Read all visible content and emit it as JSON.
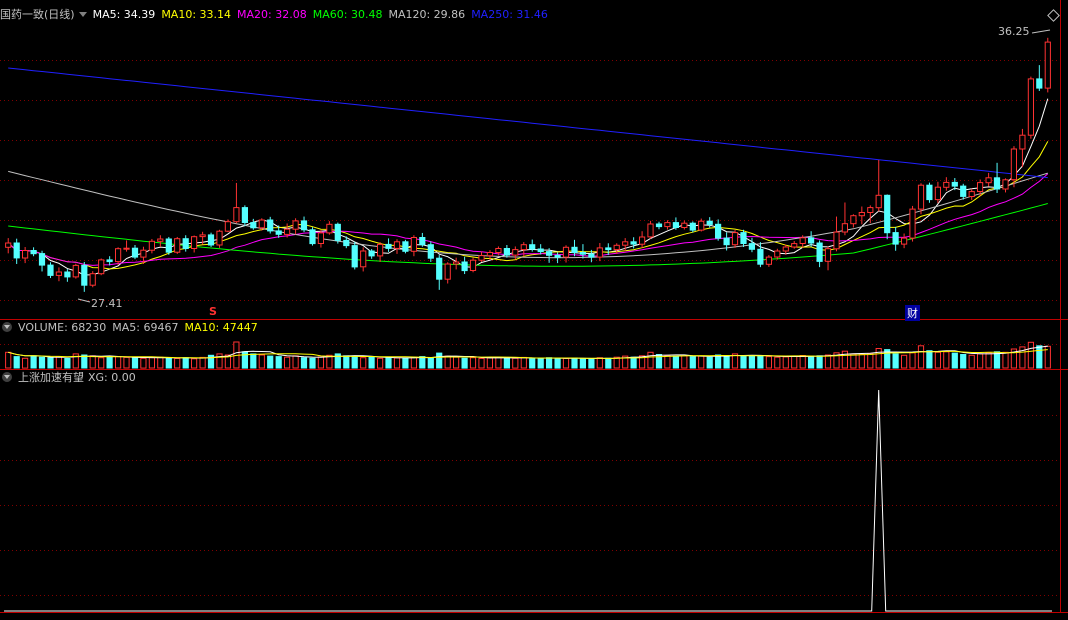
{
  "main_panel": {
    "title": "国药一致(日线)",
    "ma": [
      {
        "label": "MA5: 34.39",
        "color": "#ffffff"
      },
      {
        "label": "MA10: 33.14",
        "color": "#ffff00"
      },
      {
        "label": "MA20: 32.08",
        "color": "#ff00ff"
      },
      {
        "label": "MA60: 30.48",
        "color": "#00ff00"
      },
      {
        "label": "MA120: 29.86",
        "color": "#c0c0c0"
      },
      {
        "label": "MA250: 31.46",
        "color": "#2020ff"
      }
    ],
    "high_label": "36.25",
    "low_label": "27.41",
    "marker_s": "S",
    "marker_cai": "财"
  },
  "volume_panel": {
    "title": "VOLUME: 68230",
    "ma5": "MA5: 69467",
    "ma10": "MA10: 47447"
  },
  "indicator_panel": {
    "title": "上涨加速有望",
    "xg": "XG: 0.00"
  },
  "colors": {
    "up": "#ff3232",
    "down": "#54ffff",
    "grid": "#800000",
    "divider": "#c00000",
    "background": "#000000"
  },
  "chart_data": {
    "type": "candlestick",
    "price_axis": {
      "min": 26.5,
      "max": 36.8
    },
    "notes": "approximate daily OHLC read from the figure",
    "candles": [
      [
        28.96,
        29.28,
        28.75,
        29.11
      ],
      [
        29.11,
        29.26,
        28.38,
        28.59
      ],
      [
        28.59,
        28.97,
        28.41,
        28.85
      ],
      [
        28.85,
        28.96,
        28.65,
        28.74
      ],
      [
        28.74,
        28.84,
        28.12,
        28.34
      ],
      [
        28.34,
        28.44,
        27.89,
        27.98
      ],
      [
        27.98,
        28.26,
        27.78,
        28.1
      ],
      [
        28.1,
        28.2,
        27.76,
        27.93
      ],
      [
        27.93,
        28.39,
        27.87,
        28.33
      ],
      [
        28.33,
        28.45,
        27.41,
        27.64
      ],
      [
        27.64,
        28.13,
        27.57,
        28.04
      ],
      [
        28.04,
        28.57,
        27.99,
        28.52
      ],
      [
        28.52,
        28.65,
        28.33,
        28.46
      ],
      [
        28.46,
        28.96,
        28.35,
        28.91
      ],
      [
        28.91,
        29.2,
        28.81,
        28.93
      ],
      [
        28.93,
        29.04,
        28.55,
        28.62
      ],
      [
        28.62,
        28.98,
        28.38,
        28.86
      ],
      [
        28.86,
        29.25,
        28.75,
        29.17
      ],
      [
        29.17,
        29.38,
        28.97,
        29.25
      ],
      [
        29.25,
        29.32,
        28.7,
        28.79
      ],
      [
        28.79,
        29.32,
        28.73,
        29.26
      ],
      [
        29.26,
        29.38,
        28.81,
        28.92
      ],
      [
        28.92,
        29.37,
        28.78,
        29.33
      ],
      [
        29.33,
        29.5,
        29.06,
        29.39
      ],
      [
        29.39,
        29.47,
        28.97,
        29.04
      ],
      [
        29.04,
        29.57,
        28.94,
        29.52
      ],
      [
        29.52,
        29.93,
        29.49,
        29.85
      ],
      [
        29.85,
        31.2,
        29.8,
        30.34
      ],
      [
        30.34,
        30.42,
        29.7,
        29.82
      ],
      [
        29.82,
        29.95,
        29.57,
        29.64
      ],
      [
        29.64,
        29.97,
        29.54,
        29.91
      ],
      [
        29.91,
        30.02,
        29.44,
        29.53
      ],
      [
        29.53,
        29.72,
        29.29,
        29.41
      ],
      [
        29.41,
        29.79,
        29.3,
        29.59
      ],
      [
        29.59,
        29.97,
        29.41,
        29.88
      ],
      [
        29.88,
        30.03,
        29.49,
        29.57
      ],
      [
        29.57,
        29.66,
        29.02,
        29.09
      ],
      [
        29.09,
        29.56,
        28.95,
        29.46
      ],
      [
        29.46,
        29.87,
        29.4,
        29.76
      ],
      [
        29.76,
        29.82,
        29.09,
        29.2
      ],
      [
        29.2,
        29.34,
        28.93,
        29.02
      ],
      [
        29.02,
        29.15,
        28.19,
        28.28
      ],
      [
        28.28,
        28.96,
        28.12,
        28.83
      ],
      [
        28.83,
        28.9,
        28.56,
        28.66
      ],
      [
        28.66,
        29.14,
        28.45,
        29.06
      ],
      [
        29.06,
        29.27,
        28.8,
        28.92
      ],
      [
        28.92,
        29.24,
        28.73,
        29.15
      ],
      [
        29.15,
        29.22,
        28.75,
        28.82
      ],
      [
        28.82,
        29.38,
        28.65,
        29.3
      ],
      [
        29.3,
        29.46,
        28.98,
        29.05
      ],
      [
        29.05,
        29.16,
        28.45,
        28.58
      ],
      [
        28.58,
        28.69,
        27.48,
        27.85
      ],
      [
        27.85,
        28.44,
        27.7,
        28.38
      ],
      [
        28.38,
        28.6,
        28.19,
        28.45
      ],
      [
        28.45,
        28.63,
        28.03,
        28.15
      ],
      [
        28.15,
        28.6,
        28.09,
        28.51
      ],
      [
        28.51,
        28.81,
        28.45,
        28.67
      ],
      [
        28.67,
        28.86,
        28.52,
        28.78
      ],
      [
        28.78,
        28.99,
        28.68,
        28.92
      ],
      [
        28.92,
        29.04,
        28.6,
        28.69
      ],
      [
        28.69,
        28.99,
        28.53,
        28.88
      ],
      [
        28.88,
        29.14,
        28.64,
        29.05
      ],
      [
        29.05,
        29.23,
        28.81,
        28.9
      ],
      [
        28.9,
        29.07,
        28.71,
        28.81
      ],
      [
        28.81,
        28.93,
        28.42,
        28.68
      ],
      [
        28.68,
        28.78,
        28.41,
        28.62
      ],
      [
        28.62,
        29.03,
        28.43,
        28.96
      ],
      [
        28.96,
        29.22,
        28.65,
        28.78
      ],
      [
        28.78,
        29.07,
        28.57,
        28.72
      ],
      [
        28.72,
        28.87,
        28.44,
        28.62
      ],
      [
        28.62,
        29.11,
        28.48,
        28.94
      ],
      [
        28.94,
        29.1,
        28.69,
        28.88
      ],
      [
        28.88,
        29.1,
        28.73,
        29.03
      ],
      [
        29.03,
        29.28,
        28.83,
        29.15
      ],
      [
        29.15,
        29.31,
        28.92,
        29.07
      ],
      [
        29.07,
        29.52,
        28.93,
        29.32
      ],
      [
        29.32,
        29.88,
        29.26,
        29.77
      ],
      [
        29.77,
        29.85,
        29.59,
        29.68
      ],
      [
        29.68,
        29.9,
        29.58,
        29.82
      ],
      [
        29.82,
        30.0,
        29.57,
        29.65
      ],
      [
        29.65,
        29.89,
        29.58,
        29.8
      ],
      [
        29.8,
        29.86,
        29.48,
        29.56
      ],
      [
        29.56,
        29.96,
        29.51,
        29.87
      ],
      [
        29.87,
        30.01,
        29.65,
        29.76
      ],
      [
        29.76,
        29.93,
        29.19,
        29.28
      ],
      [
        29.28,
        29.48,
        28.85,
        29.05
      ],
      [
        29.05,
        29.56,
        28.94,
        29.47
      ],
      [
        29.47,
        29.57,
        28.97,
        29.09
      ],
      [
        29.09,
        29.29,
        28.79,
        28.89
      ],
      [
        28.89,
        29.14,
        28.27,
        28.37
      ],
      [
        28.37,
        28.69,
        28.28,
        28.62
      ],
      [
        28.62,
        28.91,
        28.53,
        28.83
      ],
      [
        28.83,
        29.06,
        28.7,
        28.97
      ],
      [
        28.97,
        29.18,
        28.91,
        29.09
      ],
      [
        29.09,
        29.38,
        28.94,
        29.29
      ],
      [
        29.29,
        29.52,
        28.98,
        29.11
      ],
      [
        29.11,
        29.2,
        28.27,
        28.47
      ],
      [
        28.47,
        28.99,
        28.16,
        28.91
      ],
      [
        28.91,
        30.03,
        28.82,
        29.49
      ],
      [
        29.49,
        30.52,
        29.38,
        29.78
      ],
      [
        29.78,
        30.11,
        29.65,
        30.06
      ],
      [
        30.06,
        30.38,
        29.76,
        30.17
      ],
      [
        30.17,
        30.42,
        29.8,
        30.34
      ],
      [
        30.34,
        32.0,
        30.21,
        30.77
      ],
      [
        30.77,
        30.8,
        29.24,
        29.47
      ],
      [
        29.47,
        29.67,
        28.84,
        29.07
      ],
      [
        29.07,
        29.44,
        28.93,
        29.28
      ],
      [
        29.28,
        30.4,
        29.16,
        30.29
      ],
      [
        30.29,
        31.19,
        30.11,
        31.12
      ],
      [
        31.12,
        31.21,
        30.51,
        30.62
      ],
      [
        30.62,
        31.24,
        30.5,
        31.05
      ],
      [
        31.05,
        31.4,
        30.93,
        31.22
      ],
      [
        31.22,
        31.37,
        30.95,
        31.09
      ],
      [
        31.09,
        31.17,
        30.62,
        30.73
      ],
      [
        30.73,
        31.0,
        30.61,
        30.9
      ],
      [
        30.9,
        31.32,
        30.76,
        31.21
      ],
      [
        31.21,
        31.55,
        31.08,
        31.38
      ],
      [
        31.38,
        31.9,
        30.85,
        30.99
      ],
      [
        30.99,
        31.36,
        30.87,
        31.31
      ],
      [
        31.31,
        32.48,
        31.05,
        32.38
      ],
      [
        32.38,
        33.08,
        31.75,
        32.86
      ],
      [
        32.86,
        34.9,
        32.74,
        34.82
      ],
      [
        34.82,
        35.3,
        34.4,
        34.5
      ],
      [
        34.5,
        36.25,
        34.35,
        36.1
      ]
    ],
    "volume": [
      58000,
      42000,
      36000,
      45000,
      40000,
      38000,
      41000,
      35000,
      52000,
      48000,
      45000,
      38000,
      40000,
      42000,
      39000,
      37000,
      36000,
      38000,
      40000,
      37000,
      35000,
      38000,
      34000,
      39000,
      47000,
      52000,
      48000,
      96000,
      60000,
      52000,
      48000,
      44000,
      42000,
      40000,
      45000,
      38000,
      36000,
      41000,
      47000,
      52000,
      45000,
      43000,
      38000,
      40000,
      36000,
      39000,
      37000,
      35000,
      40000,
      42000,
      38000,
      55000,
      44000,
      40000,
      36000,
      38000,
      35000,
      37000,
      40000,
      38000,
      36000,
      39000,
      34000,
      35000,
      38000,
      36000,
      35000,
      37000,
      34000,
      33000,
      38000,
      36000,
      40000,
      44000,
      40000,
      45000,
      58000,
      50000,
      46000,
      43000,
      45000,
      42000,
      44000,
      40000,
      48000,
      46000,
      52000,
      45000,
      44000,
      46000,
      42000,
      40000,
      41000,
      43000,
      46000,
      44000,
      45000,
      48000,
      56000,
      62000,
      52000,
      50000,
      54000,
      72000,
      68000,
      52000,
      47000,
      56000,
      82000,
      64000,
      58000,
      60000,
      55000,
      50000,
      47000,
      52000,
      56000,
      60000,
      58000,
      70000,
      78000,
      95000,
      82000,
      80000
    ],
    "indicator_spike_index": 103
  }
}
